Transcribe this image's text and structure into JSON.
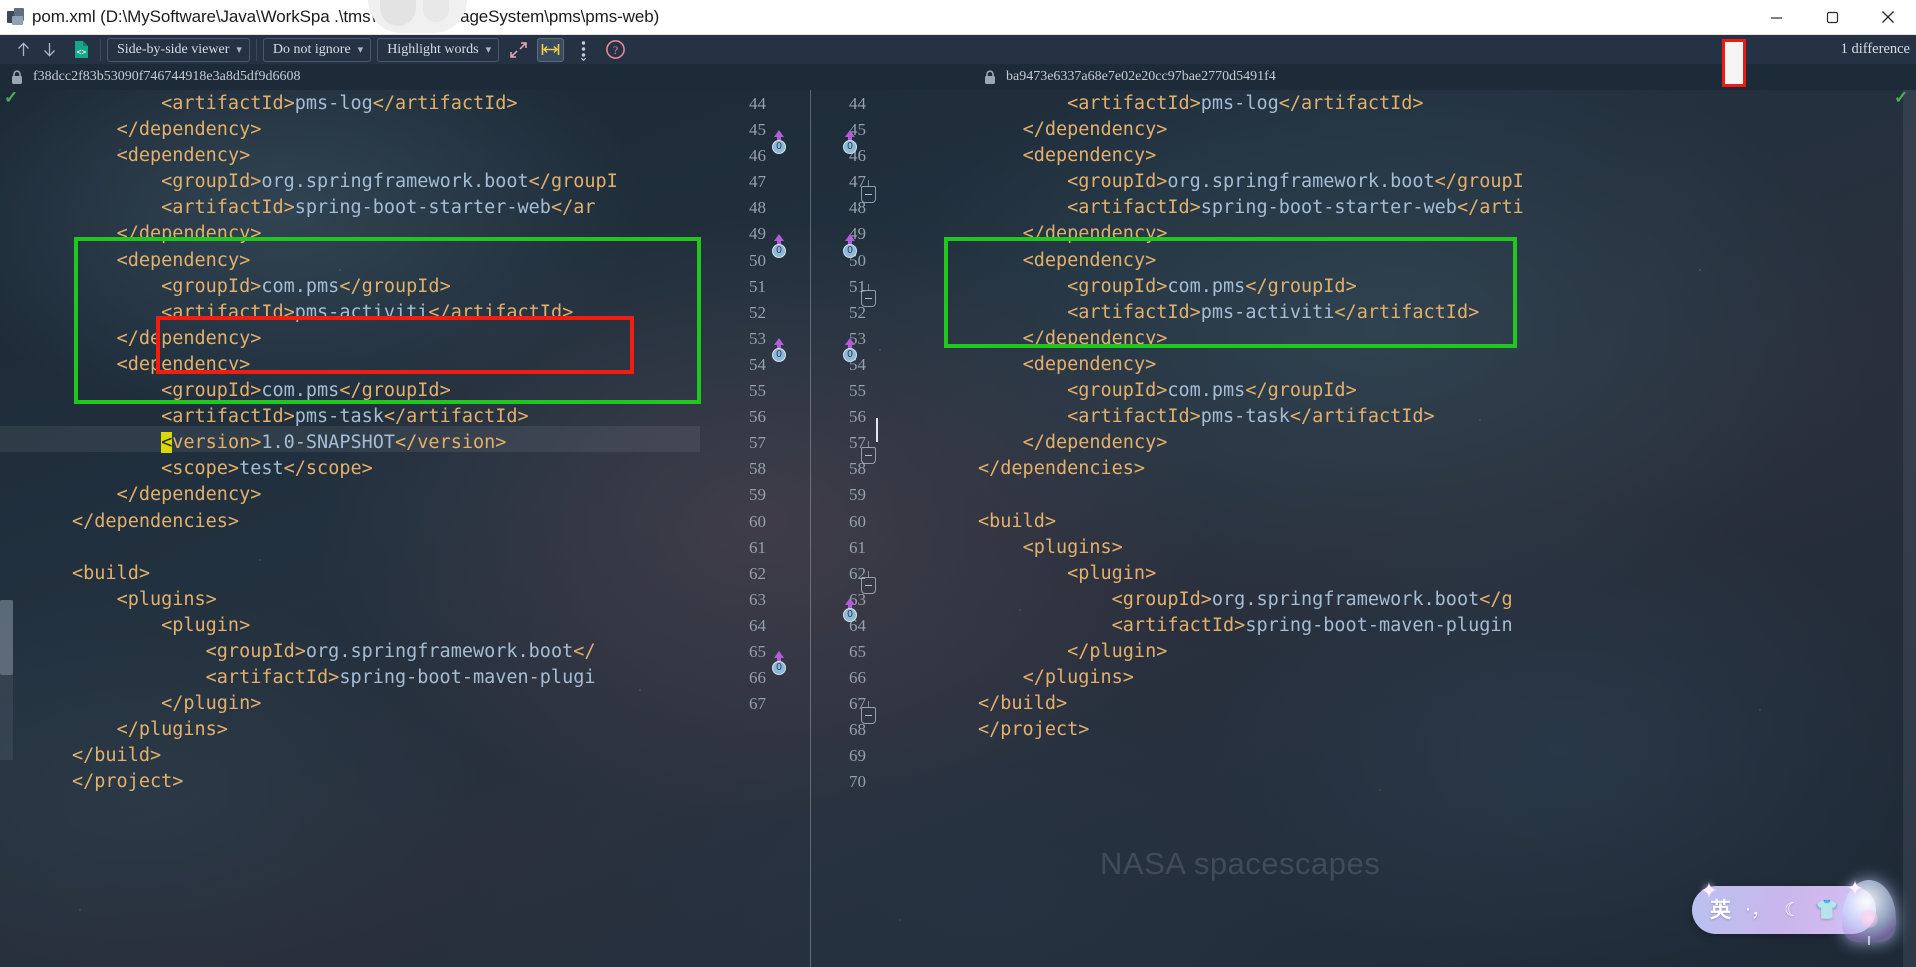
{
  "window": {
    "title": "pom.xml (D:\\MySoftware\\Java\\WorkSpa                 .\\tms\\ProjectManageSystem\\pms\\pms-web)",
    "app_icon": "diff-app-icon",
    "minimize_label": "Minimize",
    "maximize_label": "Maximize",
    "close_label": "Close"
  },
  "toolbar": {
    "prev_diff_icon": "arrow-up-icon",
    "next_diff_icon": "arrow-down-icon",
    "file_icon": "code-file-icon",
    "view_mode": "Side-by-side viewer",
    "whitespace_mode": "Do not ignore",
    "highlight_mode": "Highlight words",
    "collapse_label": "collapse-unchanged-icon",
    "align_label": "align-panes-icon",
    "more_label": "more-options-icon",
    "help_label": "help-icon",
    "difference_count": "1 difference",
    "caret": "⌄"
  },
  "revisions": {
    "left_hash": "f38dcc2f83b53090f746744918e3a8d5df9d6608",
    "right_hash": "ba9473e6337a68e7e02e20cc97bae2770d5491f4",
    "lock_icon": "lock-icon"
  },
  "left_pane": {
    "line_numbers": "44\n45\n46\n47\n48\n49\n50\n51\n52\n53\n54\n55\n56\n57\n58\n59\n60\n61\n62\n63\n64\n65\n66\n67",
    "lines": [
      {
        "indent": "        ",
        "parts": [
          {
            "t": "tag",
            "s": "<artifactId>"
          },
          {
            "t": "txt",
            "s": "pms-log"
          },
          {
            "t": "tag",
            "s": "</artifactId>"
          }
        ]
      },
      {
        "indent": "    ",
        "parts": [
          {
            "t": "tag",
            "s": "</dependency>"
          }
        ]
      },
      {
        "indent": "    ",
        "parts": [
          {
            "t": "tag",
            "s": "<dependency>"
          }
        ]
      },
      {
        "indent": "        ",
        "parts": [
          {
            "t": "tag",
            "s": "<groupId>"
          },
          {
            "t": "txt",
            "s": "org.springframework.boot"
          },
          {
            "t": "tag",
            "s": "</groupI"
          }
        ]
      },
      {
        "indent": "        ",
        "parts": [
          {
            "t": "tag",
            "s": "<artifactId>"
          },
          {
            "t": "txt",
            "s": "spring-boot-starter-web"
          },
          {
            "t": "tag",
            "s": "</ar"
          }
        ]
      },
      {
        "indent": "    ",
        "parts": [
          {
            "t": "tag",
            "s": "</dependency>"
          }
        ]
      },
      {
        "indent": "    ",
        "parts": [
          {
            "t": "tag",
            "s": "<dependency>"
          }
        ]
      },
      {
        "indent": "        ",
        "parts": [
          {
            "t": "tag",
            "s": "<groupId>"
          },
          {
            "t": "txt",
            "s": "com.pms"
          },
          {
            "t": "tag",
            "s": "</groupId>"
          }
        ]
      },
      {
        "indent": "        ",
        "parts": [
          {
            "t": "tag",
            "s": "<artifactId>"
          },
          {
            "t": "txt",
            "s": "pms-activiti"
          },
          {
            "t": "tag",
            "s": "</artifactId>"
          }
        ]
      },
      {
        "indent": "    ",
        "parts": [
          {
            "t": "tag",
            "s": "</dependency>"
          }
        ]
      },
      {
        "indent": "    ",
        "parts": [
          {
            "t": "tag",
            "s": "<dependency>"
          }
        ]
      },
      {
        "indent": "        ",
        "parts": [
          {
            "t": "tag",
            "s": "<groupId>"
          },
          {
            "t": "txt",
            "s": "com.pms"
          },
          {
            "t": "tag",
            "s": "</groupId>"
          }
        ]
      },
      {
        "indent": "        ",
        "parts": [
          {
            "t": "tag",
            "s": "<artifactId>"
          },
          {
            "t": "txt",
            "s": "pms-task"
          },
          {
            "t": "tag",
            "s": "</artifactId>"
          }
        ]
      },
      {
        "indent": "        ",
        "parts": [
          {
            "t": "hl",
            "s": "<"
          },
          {
            "t": "tag",
            "s": "version>"
          },
          {
            "t": "txt",
            "s": "1.0-SNAPSHOT"
          },
          {
            "t": "tag",
            "s": "</version>"
          }
        ]
      },
      {
        "indent": "        ",
        "parts": [
          {
            "t": "tag",
            "s": "<scope>"
          },
          {
            "t": "txt",
            "s": "test"
          },
          {
            "t": "tag",
            "s": "</scope>"
          }
        ]
      },
      {
        "indent": "    ",
        "parts": [
          {
            "t": "tag",
            "s": "</dependency>"
          }
        ]
      },
      {
        "indent": "",
        "parts": [
          {
            "t": "tag",
            "s": "</dependencies>"
          }
        ]
      },
      {
        "indent": "",
        "parts": []
      },
      {
        "indent": "",
        "parts": [
          {
            "t": "tag",
            "s": "<build>"
          }
        ]
      },
      {
        "indent": "    ",
        "parts": [
          {
            "t": "tag",
            "s": "<plugins>"
          }
        ]
      },
      {
        "indent": "        ",
        "parts": [
          {
            "t": "tag",
            "s": "<plugin>"
          }
        ]
      },
      {
        "indent": "            ",
        "parts": [
          {
            "t": "tag",
            "s": "<groupId>"
          },
          {
            "t": "txt",
            "s": "org.springframework.boot"
          },
          {
            "t": "tag",
            "s": "</"
          }
        ]
      },
      {
        "indent": "            ",
        "parts": [
          {
            "t": "tag",
            "s": "<artifactId>"
          },
          {
            "t": "txt",
            "s": "spring-boot-maven-plugi"
          }
        ]
      },
      {
        "indent": "        ",
        "parts": [
          {
            "t": "tag",
            "s": "</plugin>"
          }
        ]
      },
      {
        "indent": "    ",
        "parts": [
          {
            "t": "tag",
            "s": "</plugins>"
          }
        ]
      },
      {
        "indent": "",
        "parts": [
          {
            "t": "tag",
            "s": "</build>"
          }
        ]
      },
      {
        "indent": "",
        "parts": [
          {
            "t": "tag",
            "s": "</project>"
          }
        ]
      }
    ]
  },
  "right_pane": {
    "line_numbers": "44\n45\n46\n47\n48\n49\n50\n51\n52\n53\n54\n55\n56\n57\n58\n59\n60\n61\n62\n63\n64\n65\n66\n67\n68\n69\n70",
    "lines": [
      {
        "indent": "        ",
        "parts": [
          {
            "t": "tag",
            "s": "<artifactId>"
          },
          {
            "t": "txt",
            "s": "pms-log"
          },
          {
            "t": "tag",
            "s": "</artifactId>"
          }
        ]
      },
      {
        "indent": "    ",
        "parts": [
          {
            "t": "tag",
            "s": "</dependency>"
          }
        ]
      },
      {
        "indent": "    ",
        "parts": [
          {
            "t": "tag",
            "s": "<dependency>"
          }
        ]
      },
      {
        "indent": "        ",
        "parts": [
          {
            "t": "tag",
            "s": "<groupId>"
          },
          {
            "t": "txt",
            "s": "org.springframework.boot"
          },
          {
            "t": "tag",
            "s": "</groupI"
          }
        ]
      },
      {
        "indent": "        ",
        "parts": [
          {
            "t": "tag",
            "s": "<artifactId>"
          },
          {
            "t": "txt",
            "s": "spring-boot-starter-web"
          },
          {
            "t": "tag",
            "s": "</arti"
          }
        ]
      },
      {
        "indent": "    ",
        "parts": [
          {
            "t": "tag",
            "s": "</dependency>"
          }
        ]
      },
      {
        "indent": "    ",
        "parts": [
          {
            "t": "tag",
            "s": "<dependency>"
          }
        ]
      },
      {
        "indent": "        ",
        "parts": [
          {
            "t": "tag",
            "s": "<groupId>"
          },
          {
            "t": "txt",
            "s": "com.pms"
          },
          {
            "t": "tag",
            "s": "</groupId>"
          }
        ]
      },
      {
        "indent": "        ",
        "parts": [
          {
            "t": "tag",
            "s": "<artifactId>"
          },
          {
            "t": "txt",
            "s": "pms-activiti"
          },
          {
            "t": "tag",
            "s": "</artifactId>"
          }
        ]
      },
      {
        "indent": "    ",
        "parts": [
          {
            "t": "tag",
            "s": "</dependency>"
          }
        ]
      },
      {
        "indent": "    ",
        "parts": [
          {
            "t": "tag",
            "s": "<dependency>"
          }
        ]
      },
      {
        "indent": "        ",
        "parts": [
          {
            "t": "tag",
            "s": "<groupId>"
          },
          {
            "t": "txt",
            "s": "com.pms"
          },
          {
            "t": "tag",
            "s": "</groupId>"
          }
        ]
      },
      {
        "indent": "        ",
        "parts": [
          {
            "t": "tag",
            "s": "<artifactId>"
          },
          {
            "t": "txt",
            "s": "pms-task"
          },
          {
            "t": "tag",
            "s": "</artifactId>"
          }
        ]
      },
      {
        "indent": "    ",
        "parts": [
          {
            "t": "tag",
            "s": "</dependency>"
          }
        ]
      },
      {
        "indent": "",
        "parts": [
          {
            "t": "tag",
            "s": "</dependencies>"
          }
        ]
      },
      {
        "indent": "",
        "parts": []
      },
      {
        "indent": "",
        "parts": [
          {
            "t": "tag",
            "s": "<build>"
          }
        ]
      },
      {
        "indent": "    ",
        "parts": [
          {
            "t": "tag",
            "s": "<plugins>"
          }
        ]
      },
      {
        "indent": "        ",
        "parts": [
          {
            "t": "tag",
            "s": "<plugin>"
          }
        ]
      },
      {
        "indent": "            ",
        "parts": [
          {
            "t": "tag",
            "s": "<groupId>"
          },
          {
            "t": "txt",
            "s": "org.springframework.boot"
          },
          {
            "t": "tag",
            "s": "</g"
          }
        ]
      },
      {
        "indent": "            ",
        "parts": [
          {
            "t": "tag",
            "s": "<artifactId>"
          },
          {
            "t": "txt",
            "s": "spring-boot-maven-plugin"
          }
        ]
      },
      {
        "indent": "        ",
        "parts": [
          {
            "t": "tag",
            "s": "</plugin>"
          }
        ]
      },
      {
        "indent": "    ",
        "parts": [
          {
            "t": "tag",
            "s": "</plugins>"
          }
        ]
      },
      {
        "indent": "",
        "parts": [
          {
            "t": "tag",
            "s": "</build>"
          }
        ]
      },
      {
        "indent": "",
        "parts": [
          {
            "t": "tag",
            "s": "</project>"
          }
        ]
      }
    ]
  },
  "annotations": {
    "green_color": "#1fc71f",
    "red_color": "#f21d11",
    "green_left_label": "dependency-block-left",
    "green_right_label": "dependency-block-right",
    "red_left_label": "version-scope-diff",
    "red_toolbar_label": "toolbar-redacted-highlight"
  },
  "gutter": {
    "change_markers": [
      "46",
      "50",
      "54",
      "66"
    ],
    "marker_badge": "0",
    "fold_markers": [
      "48",
      "52",
      "58",
      "63",
      "67",
      "68"
    ]
  },
  "watermark": {
    "text": "NASA spacescapes"
  },
  "ime": {
    "language": "英",
    "punctuation": "·，",
    "mode_icon": "☾",
    "skin_icon": "👕",
    "sparkle_icon": "✦"
  }
}
